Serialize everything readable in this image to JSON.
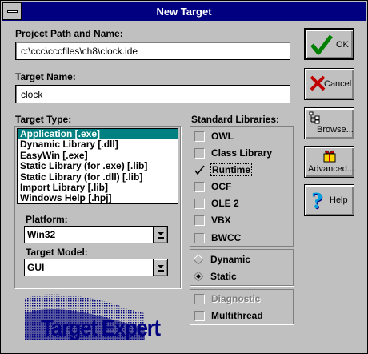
{
  "window": {
    "title": "New Target"
  },
  "project_path": {
    "label": "Project Path and Name:",
    "value": "c:\\ccc\\cccfiles\\ch8\\clock.ide"
  },
  "target_name": {
    "label": "Target Name:",
    "value": "clock"
  },
  "target_type": {
    "label": "Target Type:",
    "items": [
      "Application [.exe]",
      "Dynamic Library [.dll]",
      "EasyWin [.exe]",
      "Static Library (for .exe) [.lib]",
      "Static Library (for .dll) [.lib]",
      "Import Library [.lib]",
      "Windows Help [.hpj]"
    ],
    "selected": "Application [.exe]"
  },
  "platform": {
    "label": "Platform:",
    "value": "Win32"
  },
  "target_model": {
    "label": "Target Model:",
    "value": "GUI"
  },
  "standard_libraries": {
    "label": "Standard Libraries:",
    "items": [
      {
        "label": "OWL",
        "checked": false
      },
      {
        "label": "Class Library",
        "checked": false
      },
      {
        "label": "Runtime",
        "checked": true
      },
      {
        "label": "OCF",
        "checked": false
      },
      {
        "label": "OLE 2",
        "checked": false
      },
      {
        "label": "VBX",
        "checked": false
      },
      {
        "label": "BWCC",
        "checked": false
      }
    ],
    "linkage": [
      {
        "label": "Dynamic",
        "selected": false,
        "enabled": false
      },
      {
        "label": "Static",
        "selected": true,
        "enabled": true
      }
    ],
    "diagnostic": {
      "label": "Diagnostic",
      "checked": false,
      "enabled": false
    },
    "multithread": {
      "label": "Multithread",
      "checked": false,
      "enabled": true
    }
  },
  "buttons": {
    "ok": "OK",
    "cancel": "Cancel",
    "browse": "Browse...",
    "advanced": "Advanced...",
    "help": "Help"
  },
  "logo": {
    "text": "Target Expert"
  },
  "colors": {
    "titlebar": "#000080",
    "selection": "#008080",
    "ok_check": "#008000",
    "cancel_x": "#c00000"
  }
}
